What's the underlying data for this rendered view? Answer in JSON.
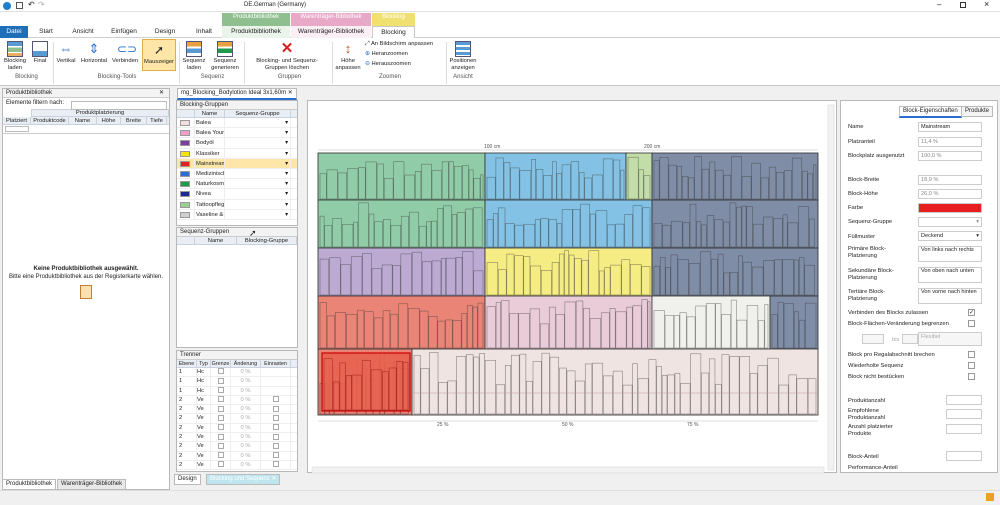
{
  "titlebar": {
    "language": "DE.German (Germany)"
  },
  "context_tabs": [
    {
      "label": "Produktbibliothek"
    },
    {
      "label": "Warenträger-Bibliothek"
    },
    {
      "label": "Blocking"
    }
  ],
  "tabs": [
    {
      "label": "Datei"
    },
    {
      "label": "Start"
    },
    {
      "label": "Ansicht"
    },
    {
      "label": "Einfügen"
    },
    {
      "label": "Design"
    },
    {
      "label": "Inhalt"
    },
    {
      "label": "Produktbibliothek"
    },
    {
      "label": "Warenträger-Bibliothek"
    },
    {
      "label": "Blocking"
    }
  ],
  "ribbon": {
    "blocking_laden": "Blocking laden",
    "final": "Final",
    "vertikal": "Vertikal",
    "horizontal": "Horizontal",
    "verbinden": "Verbinden",
    "mauszeiger": "Mauszeiger",
    "sequenz_laden": "Sequenz laden",
    "sequenz_generieren": "Sequenz generieren",
    "loeschen": "Blocking- und Sequenz-Gruppen löschen",
    "hoehe": "Höhe anpassen",
    "fit": "An Bildschirm anpassen",
    "zoom_in": "Heranzoomen",
    "zoom_out": "Herauszoomen",
    "positionen": "Positionen anzeigen",
    "groups": {
      "blocking": "Blocking",
      "tools": "Blocking-Tools",
      "sequenz": "Sequenz",
      "gruppen": "Gruppen",
      "zoomen": "Zoomen",
      "ansicht": "Ansicht"
    }
  },
  "left_panel": {
    "title": "Produktbibliothek",
    "filter_label": "Elemente filtern nach:",
    "group_header": "Produktplatzierung",
    "columns": [
      "Platziert",
      "Produktcode",
      "Name",
      "Höhe",
      "Breite",
      "Tiefe"
    ],
    "empty_title": "Keine Produktbibliothek ausgewählt.",
    "empty_sub": "Bitte eine Produktbibliothek aus der Registerkarte wählen.",
    "bottom_tabs": [
      "Produktbibliothek",
      "Warenträger-Bibliothek"
    ]
  },
  "doc_tab": "mg_Blocking_Bodylotion Ideal 3x1,60m",
  "blocking_groups": {
    "title": "Blocking-Gruppen",
    "columns": [
      "Name",
      "Sequenz-Gruppe"
    ],
    "rows": [
      {
        "name": "Balea",
        "color": "#f2dede"
      },
      {
        "name": "Balea Young",
        "color": "#f2a0c8"
      },
      {
        "name": "Bodyöl",
        "color": "#7b3fa0"
      },
      {
        "name": "Klassiker",
        "color": "#f5e600"
      },
      {
        "name": "Mainstream",
        "color": "#e62020"
      },
      {
        "name": "Medizinisch",
        "color": "#2a6fd0"
      },
      {
        "name": "Naturkosme",
        "color": "#1f9a4a"
      },
      {
        "name": "Nivea",
        "color": "#1a2a8c"
      },
      {
        "name": "Tattoopflege",
        "color": "#9ad090"
      },
      {
        "name": "Vaseline & I",
        "color": "#d0d0d0"
      }
    ]
  },
  "sequenz_groups": {
    "title": "Sequenz-Gruppen",
    "columns": [
      "Name",
      "Blocking-Gruppe"
    ]
  },
  "trenner": {
    "title": "Trenner",
    "columns": [
      "Ebene",
      "Typ",
      "Grenze",
      "Änderung",
      "Einrasten"
    ],
    "rows": [
      {
        "ebene": "1",
        "typ": "Hc",
        "aend": "0 %"
      },
      {
        "ebene": "1",
        "typ": "Hc",
        "aend": "0 %"
      },
      {
        "ebene": "1",
        "typ": "Hc",
        "aend": "0 %"
      },
      {
        "ebene": "2",
        "typ": "Ve",
        "aend": "0 %"
      },
      {
        "ebene": "2",
        "typ": "Ve",
        "aend": "0 %"
      },
      {
        "ebene": "2",
        "typ": "Ve",
        "aend": "0 %"
      },
      {
        "ebene": "2",
        "typ": "Ve",
        "aend": "0 %"
      },
      {
        "ebene": "2",
        "typ": "Ve",
        "aend": "0 %"
      },
      {
        "ebene": "2",
        "typ": "Ve",
        "aend": "0 %"
      },
      {
        "ebene": "2",
        "typ": "Ve",
        "aend": "0 %"
      },
      {
        "ebene": "2",
        "typ": "Ve",
        "aend": "0 %"
      }
    ]
  },
  "bottom_doc_tabs": [
    "Design",
    "Blocking und Sequenz"
  ],
  "canvas": {
    "ruler_top": [
      "100 cm",
      "200 cm"
    ],
    "ruler_bottom": [
      "25 %",
      "50 %",
      "75 %"
    ]
  },
  "properties": {
    "tabs": [
      "Block-Eigenschaften",
      "Produkte"
    ],
    "name_label": "Name",
    "name_value": "Mainstream",
    "platzanteil_label": "Platzanteil",
    "platzanteil_value": "11,4 %",
    "blockplatz_label": "Blockplatz ausgenutzt",
    "blockplatz_value": "100,0 %",
    "breite_label": "Block-Breite",
    "breite_value": "18,9 %",
    "hoehe_label": "Block-Höhe",
    "hoehe_value": "26,0 %",
    "farbe_label": "Farbe",
    "farbe_value": "#e61e1e",
    "sequenz_label": "Sequenz-Gruppe",
    "fuell_label": "Füllmuster",
    "fuell_value": "Deckend",
    "primaer_label": "Primäre Block-Platzierung",
    "primaer_value": "Von links nach rechts",
    "sekundaer_label": "Sekundäre Block-Platzierung",
    "sekundaer_value": "Von oben nach unten",
    "tertiaer_label": "Tertiäre Block-Platzierung",
    "tertiaer_value": "Von vorne nach hinten",
    "verbinden_label": "Verbinden des Blocks zulassen",
    "flaechen_label": "Block-Flächen-Veränderung begrenzen",
    "bis_label": "bis",
    "flaechen_value": "Flexibel",
    "regal_label": "Block pro Regalabschnitt brechen",
    "wiederholte_label": "Wiederholte Sequenz",
    "nicht_label": "Block nicht bestücken",
    "produktanzahl_label": "Produktanzahl",
    "empfohlen_label": "Empfohlene Produktanzahl",
    "anzahl_label": "Anzahl platzierter Produkte",
    "anteil_label": "Block-Anteil",
    "perf_label": "Performance-Anteil"
  }
}
